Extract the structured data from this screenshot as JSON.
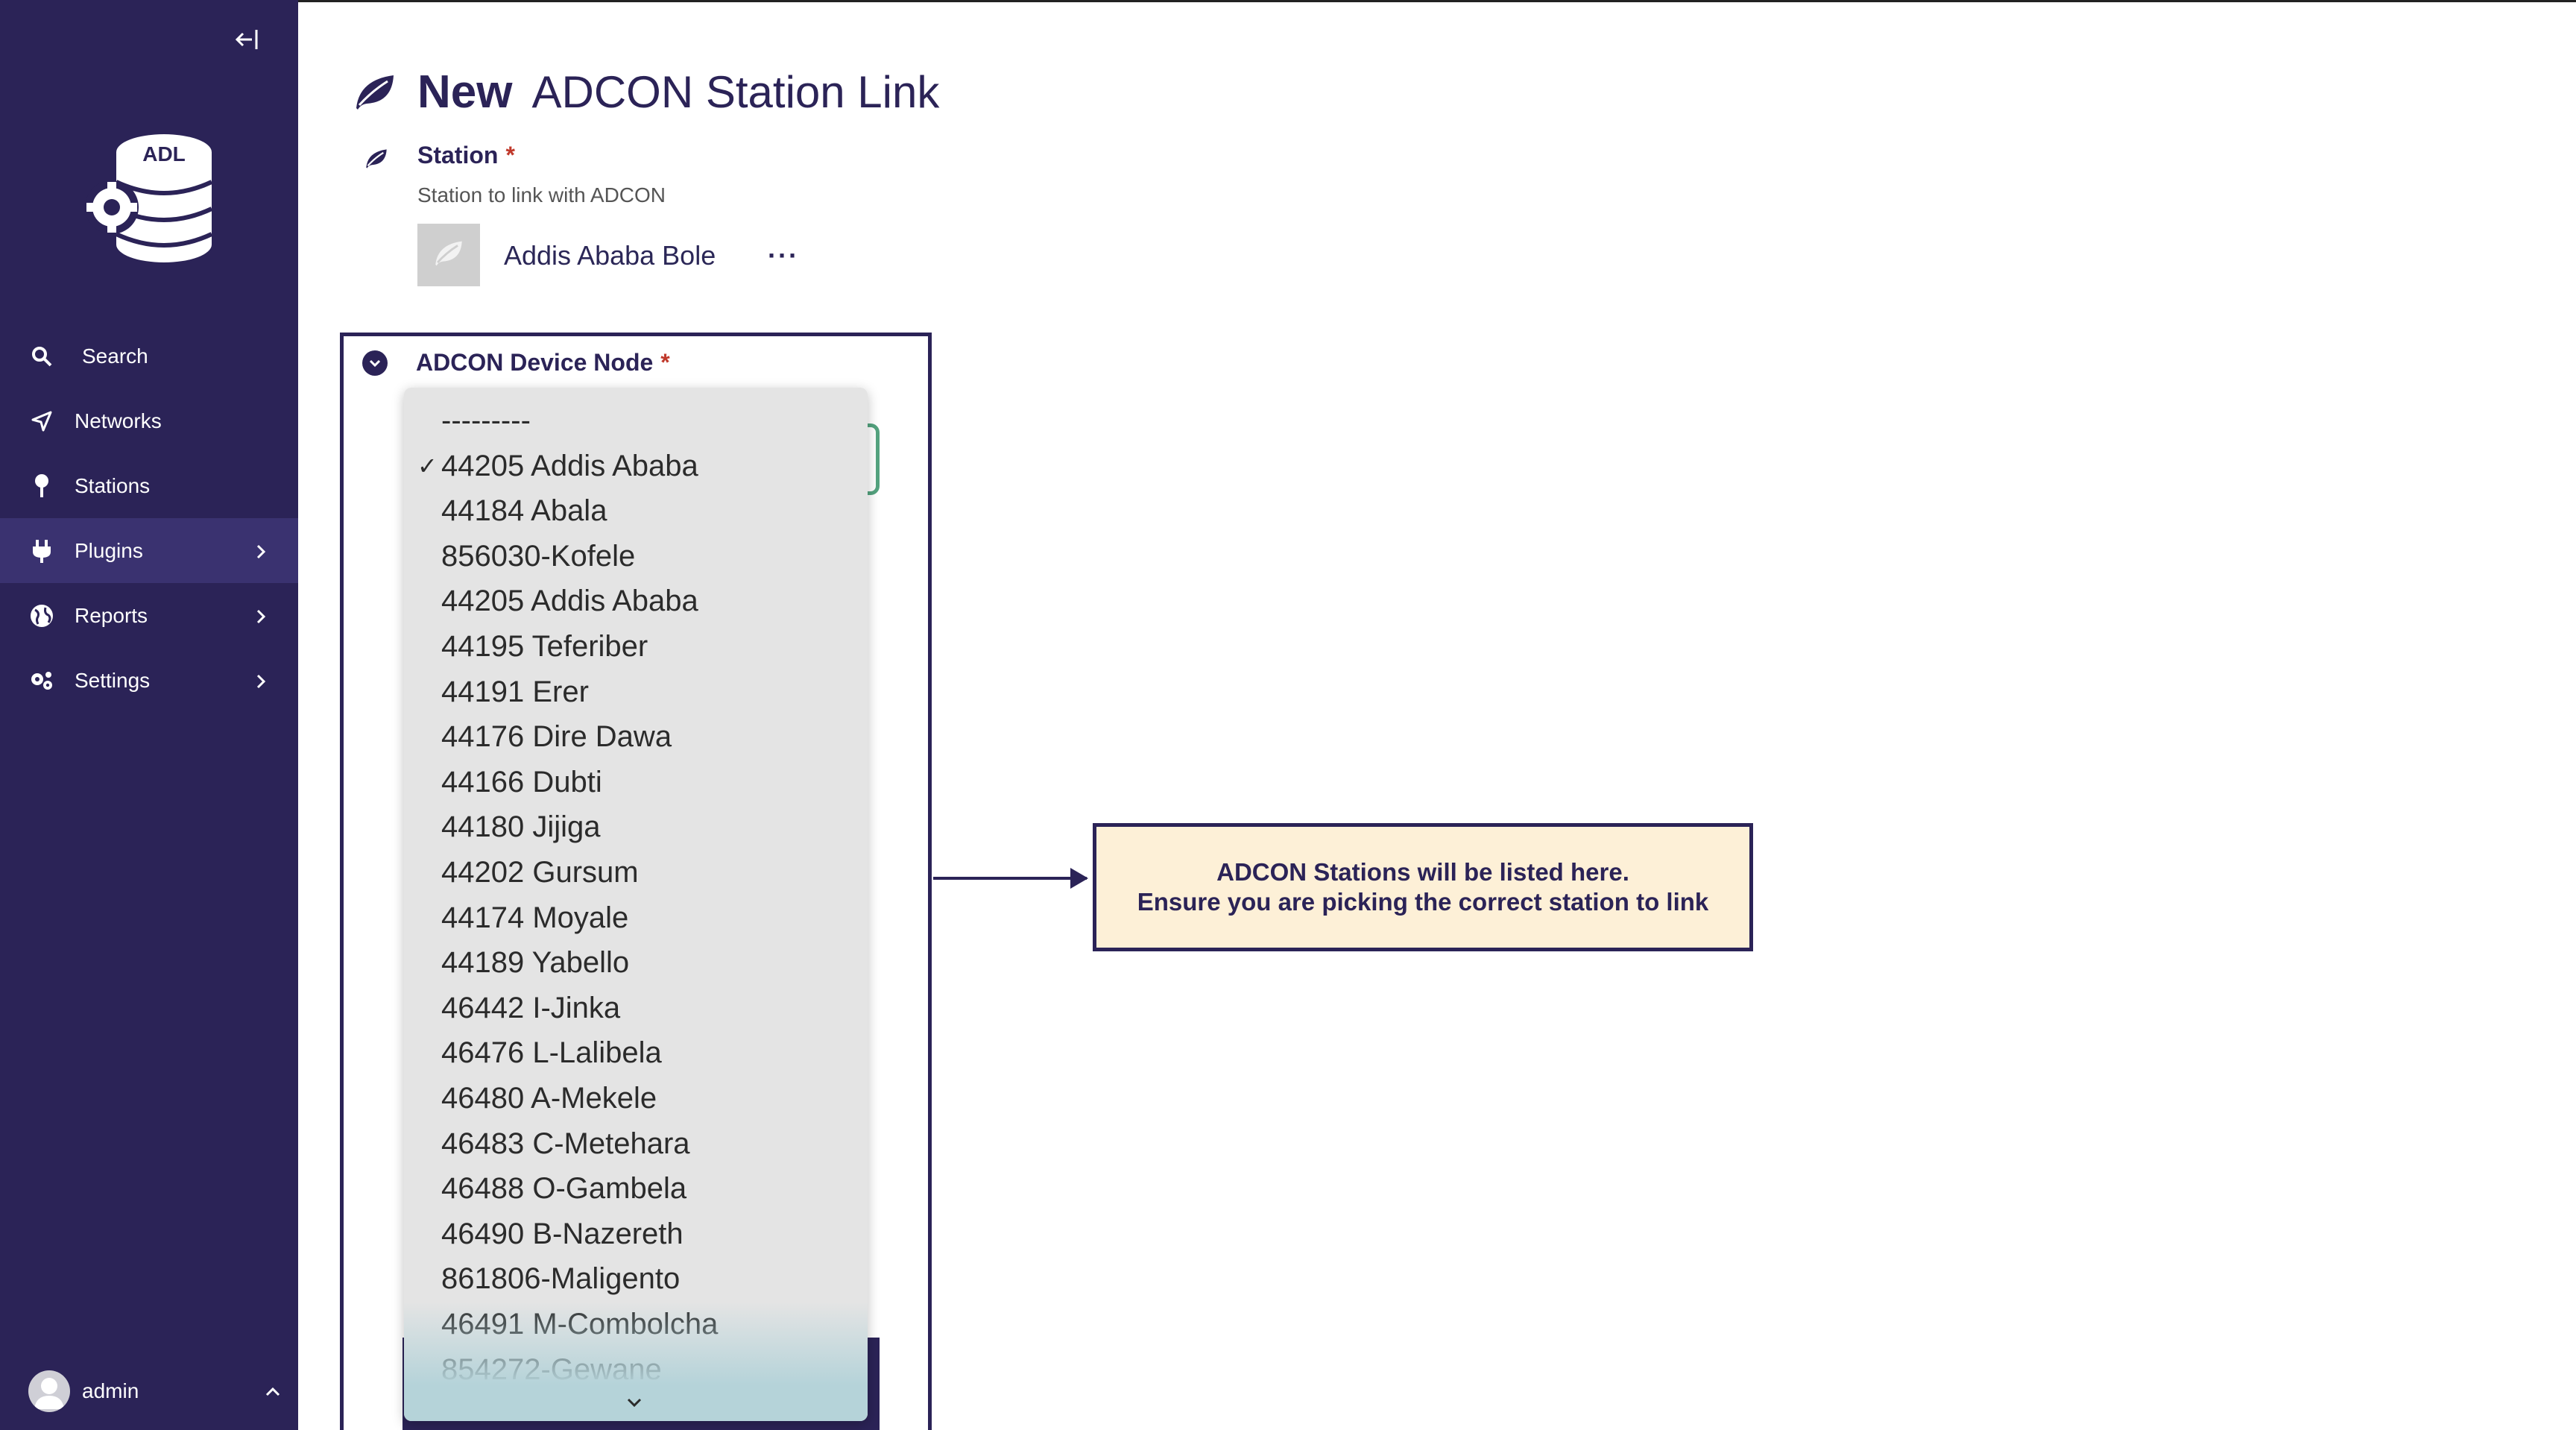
{
  "sidebar": {
    "collapse_icon": "collapse-left-icon",
    "logo_text": "ADL",
    "nav": [
      {
        "label": "Search",
        "icon": "search-icon"
      },
      {
        "label": "Networks",
        "icon": "networks-icon"
      },
      {
        "label": "Stations",
        "icon": "map-pin-icon"
      },
      {
        "label": "Plugins",
        "icon": "plug-icon",
        "has_submenu": true,
        "active": true
      },
      {
        "label": "Reports",
        "icon": "globe-icon",
        "has_submenu": true
      },
      {
        "label": "Settings",
        "icon": "gears-icon",
        "has_submenu": true
      }
    ],
    "user": {
      "name": "admin"
    }
  },
  "page": {
    "title_bold": "New",
    "title_rest": "ADCON Station Link"
  },
  "station_field": {
    "label": "Station",
    "required_mark": "*",
    "help": "Station to link with ADCON",
    "value": "Addis Ababa Bole",
    "more": "···"
  },
  "device_field": {
    "label": "ADCON Device Node",
    "required_mark": "*"
  },
  "dropdown": {
    "selected_index": 1,
    "check": "✓",
    "options": [
      "---------",
      "44205 Addis Ababa",
      "44184 Abala",
      "856030-Kofele",
      "44205 Addis Ababa",
      "44195 Teferiber",
      "44191 Erer",
      "44176 Dire Dawa",
      "44166 Dubti",
      "44180 Jijiga",
      "44202 Gursum",
      "44174 Moyale",
      "44189 Yabello",
      "46442 I-Jinka",
      "46476 L-Lalibela",
      "46480 A-Mekele",
      "46483 C-Metehara",
      "46488 O-Gambela",
      "46490 B-Nazereth",
      "861806-Maligento",
      "46491 M-Combolcha",
      "854272-Gewane"
    ]
  },
  "annotation": {
    "line1": "ADCON Stations will be listed here.",
    "line2": "Ensure you are picking the correct station to link",
    "bg": "#fdf0d7",
    "border": "#2b2357"
  },
  "colors": {
    "sidebar": "#2b2357",
    "active_nav": "#3a3270",
    "required": "#c0392b",
    "select_focus": "#54a37f"
  }
}
